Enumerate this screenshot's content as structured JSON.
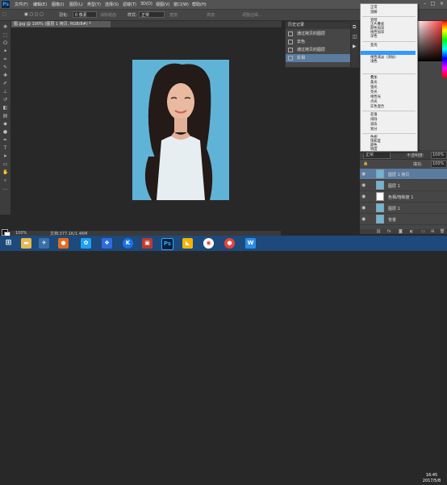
{
  "app": {
    "logo": "Ps"
  },
  "menubar": {
    "items": [
      "文件(F)",
      "编辑(E)",
      "图像(I)",
      "图层(L)",
      "类型(Y)",
      "选择(S)",
      "滤镜(T)",
      "3D(D)",
      "视图(V)",
      "窗口(W)",
      "帮助(H)"
    ]
  },
  "options": {
    "size_label": "0 像素",
    "antialias": "消除锯齿",
    "style_label": "样式:",
    "style_value": "正常",
    "width_label": "宽度:",
    "height_label": "高度:",
    "refine_label": "调整边缘..."
  },
  "document": {
    "tab_label": "图.jpg @ 100% (图层 1 拷贝, RGB/8#) *"
  },
  "status": {
    "zoom": "100%",
    "doc_info": "文档:377.1K/1.46M"
  },
  "history": {
    "title": "历史记录",
    "items": [
      "通过拷贝的图层",
      "去色",
      "通过拷贝的图层",
      "反相"
    ]
  },
  "blend_menu": {
    "groups": [
      [
        "正常",
        "溶解"
      ],
      [
        "变暗",
        "正片叠底",
        "颜色加深",
        "线性加深",
        "深色"
      ],
      [
        "变亮",
        "滤色",
        "颜色减淡",
        "线性减淡（添加）",
        "浅色"
      ],
      [
        "叠加",
        "柔光",
        "强光",
        "亮光",
        "线性光",
        "点光",
        "实色混合"
      ],
      [
        "差值",
        "排除",
        "减去",
        "划分"
      ],
      [
        "色相",
        "饱和度",
        "颜色",
        "明度"
      ]
    ],
    "selected": "滤色"
  },
  "layers": {
    "blend_value": "正常",
    "opacity_label": "不透明度:",
    "opacity_value": "100%",
    "fill_label": "填充:",
    "fill_value": "100%",
    "items": [
      {
        "name": "图层 1 拷贝",
        "selected": true
      },
      {
        "name": "图层 1",
        "selected": false
      },
      {
        "name": "色相/饱和度 1",
        "selected": false
      },
      {
        "name": "图层 1",
        "selected": false
      },
      {
        "name": "背景",
        "selected": false
      }
    ]
  },
  "taskbar": {
    "time": "16:45",
    "date": "2017/5/8"
  },
  "colors": {
    "accent": "#3399ff",
    "canvas_bg": "#282828",
    "photo_bg": "#5fb3d6",
    "taskbar": "#1d4a7a"
  }
}
